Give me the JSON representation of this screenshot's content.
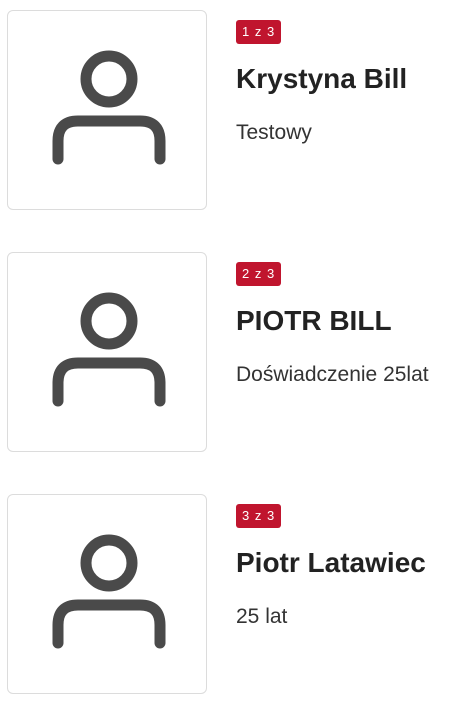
{
  "people": [
    {
      "counter": "1 z 3",
      "name": "Krystyna Bill",
      "description": "Testowy",
      "avatar_icon": "user-placeholder-icon"
    },
    {
      "counter": "2 z 3",
      "name": "PIOTR BILL",
      "description": "Doświadczenie 25lat",
      "avatar_icon": "user-placeholder-icon"
    },
    {
      "counter": "3 z 3",
      "name": "Piotr Latawiec",
      "description": "25 lat",
      "avatar_icon": "user-placeholder-icon"
    }
  ],
  "colors": {
    "badge_bg": "#c0152e",
    "icon": "#4a4a4a",
    "card_border": "#dcdcdc"
  }
}
